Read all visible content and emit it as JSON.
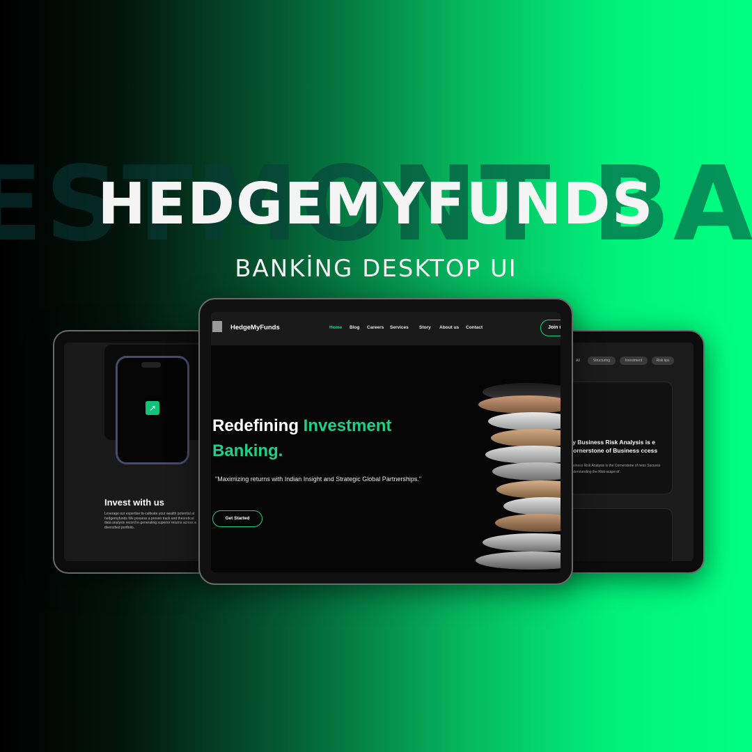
{
  "promo": {
    "background_word": "ESTMONT BANK",
    "title": "HEDGEMYFUNDS",
    "subtitle": "BANKİNG DESKTOP UI"
  },
  "colors": {
    "accent": "#1ed08a",
    "gradient_start": "#000000",
    "gradient_end": "#00ff80"
  },
  "left_screen": {
    "app_icon": "trend-up-icon",
    "heading": "Invest with us",
    "body": "Leverage our expertise to cultivate your wealth potential at hedgemyfunds We possess a proven track and theoretical data analysis record in generating superior returns across a diversified portfolio."
  },
  "main_screen": {
    "brand": "HedgeMyFunds",
    "nav": [
      "Home",
      "Blog",
      "Careers",
      "Services",
      "Story",
      "About us",
      "Contact"
    ],
    "active_nav": "Home",
    "join_button": "Join u",
    "hero_line1": "Redefining ",
    "hero_accent1": "Investment",
    "hero_accent2": "Banking.",
    "quote": "\"Maximizing returns with Indian Insight and Strategic Global Partnerships.\"",
    "cta": "Get Started"
  },
  "right_screen": {
    "chips": [
      "All",
      "Structuring",
      "Investment",
      "Risk tips"
    ],
    "card_title": "ny Business Risk Analysis is e Cornerstone of Business ccess",
    "card_text": "Business Risk Analysis is the Cornerstone of ness Success Understanding the Risk-scape of ."
  }
}
